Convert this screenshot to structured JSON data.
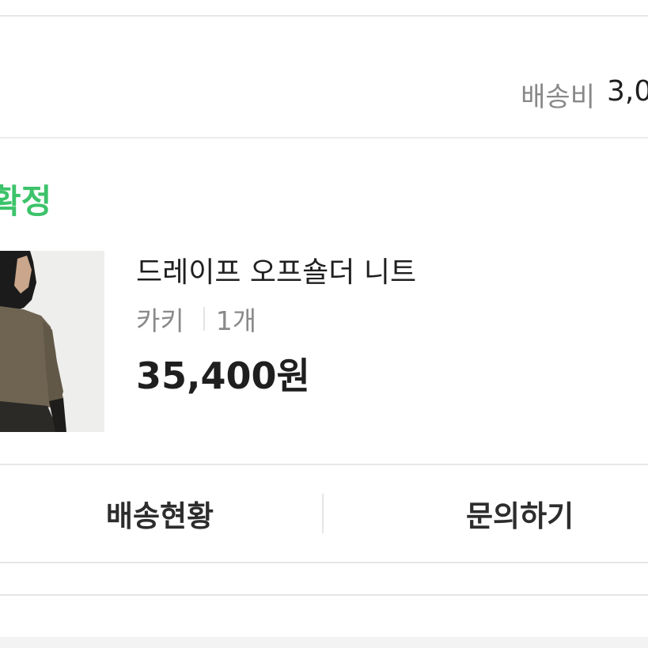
{
  "shipping": {
    "label": "배송비",
    "value": "3,0"
  },
  "order": {
    "status": "확정",
    "product": {
      "name": "드레이프 오프숄더 니트",
      "color": "카키",
      "quantity": "1개",
      "price": "35,400원"
    }
  },
  "actions": {
    "track_label": "배송현황",
    "inquiry_label": "문의하기"
  },
  "colors": {
    "status_green": "#3cc36a",
    "divider": "#e6e6e6"
  }
}
